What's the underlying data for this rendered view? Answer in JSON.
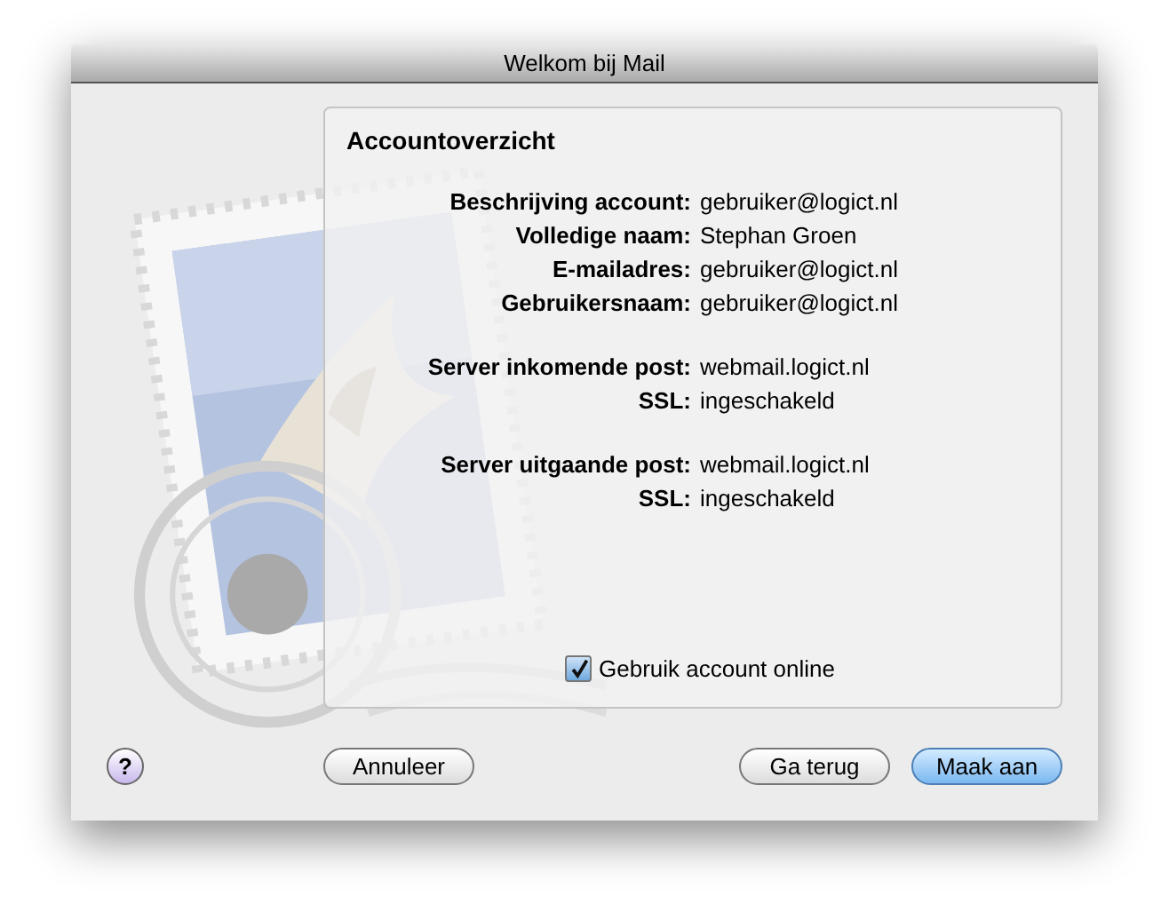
{
  "window": {
    "title": "Welkom bij Mail"
  },
  "panel": {
    "heading": "Accountoverzicht",
    "groups": [
      {
        "rows": [
          {
            "label": "Beschrijving account:",
            "value": "gebruiker@logict.nl"
          },
          {
            "label": "Volledige naam:",
            "value": "Stephan Groen"
          },
          {
            "label": "E-mailadres:",
            "value": "gebruiker@logict.nl"
          },
          {
            "label": "Gebruikersnaam:",
            "value": "gebruiker@logict.nl"
          }
        ]
      },
      {
        "rows": [
          {
            "label": "Server inkomende post:",
            "value": "webmail.logict.nl"
          },
          {
            "label": "SSL:",
            "value": "ingeschakeld"
          }
        ]
      },
      {
        "rows": [
          {
            "label": "Server uitgaande post:",
            "value": "webmail.logict.nl"
          },
          {
            "label": "SSL:",
            "value": "ingeschakeld"
          }
        ]
      }
    ],
    "checkbox": {
      "label": "Gebruik account online",
      "checked": true
    }
  },
  "help": {
    "label": "?"
  },
  "buttons": [
    {
      "label": "Annuleer",
      "default": false
    },
    {
      "label": "Ga terug",
      "default": false
    },
    {
      "label": "Maak aan",
      "default": true
    }
  ]
}
